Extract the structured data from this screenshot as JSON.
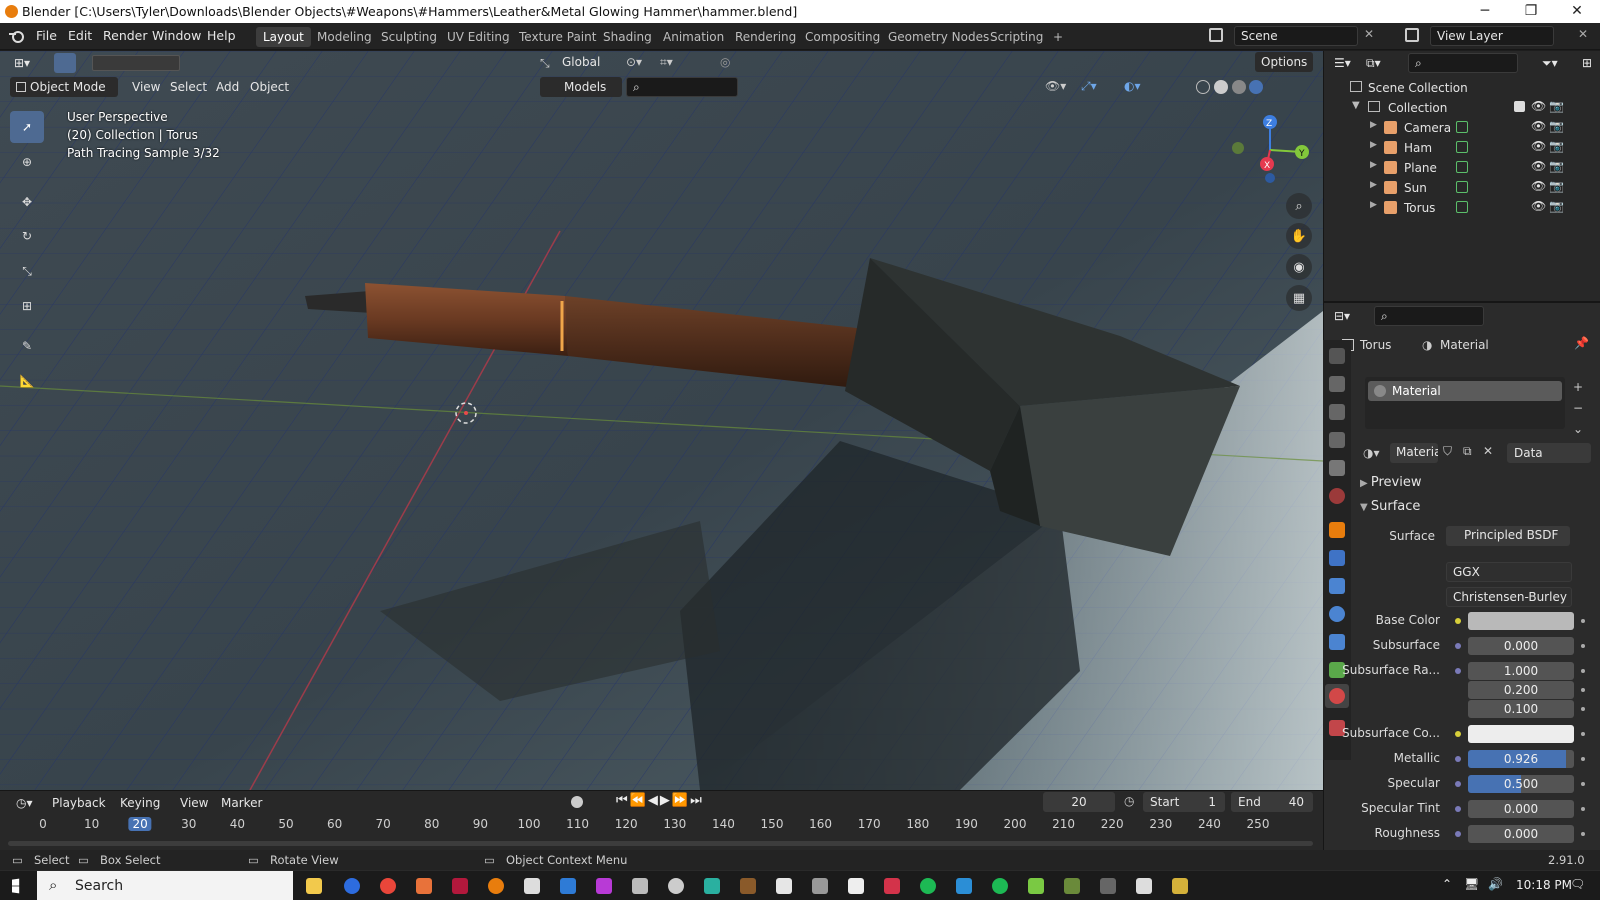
{
  "window": {
    "title": "Blender [C:\\Users\\Tyler\\Downloads\\Blender Objects\\#Weapons\\#Hammers\\Leather&Metal Glowing Hammer\\hammer.blend]",
    "min": "─",
    "max": "❐",
    "close": "✕"
  },
  "menu": [
    "File",
    "Edit",
    "Render",
    "Window",
    "Help"
  ],
  "workspaces": [
    "Layout",
    "Modeling",
    "Sculpting",
    "UV Editing",
    "Texture Paint",
    "Shading",
    "Animation",
    "Rendering",
    "Compositing",
    "Geometry Nodes",
    "Scripting"
  ],
  "add_workspace": "+",
  "scene": "Scene",
  "view_layer": "View Layer",
  "toolbar": {
    "orientation": "Global",
    "options": "Options"
  },
  "viewport_header": {
    "mode": "Object Mode",
    "view": "View",
    "select": "Select",
    "add": "Add",
    "object": "Object",
    "collection_filter": "Models"
  },
  "overlay": {
    "line1": "User Perspective",
    "line2": "(20) Collection | Torus",
    "line3": "Path Tracing Sample 3/32"
  },
  "gizmo": {
    "z": "Z",
    "y": "Y",
    "x": "X"
  },
  "timeline": {
    "playback": "Playback",
    "keying": "Keying",
    "view": "View",
    "marker": "Marker",
    "current_frame": "20",
    "start_label": "Start",
    "start": "1",
    "end_label": "End",
    "end": "40",
    "ticks": [
      "0",
      "10",
      "20",
      "30",
      "40",
      "50",
      "60",
      "70",
      "80",
      "90",
      "100",
      "110",
      "120",
      "130",
      "140",
      "150",
      "160",
      "170",
      "180",
      "190",
      "200",
      "210",
      "220",
      "230",
      "240",
      "250"
    ],
    "active_tick": "20"
  },
  "status": {
    "select": "Select",
    "box_select": "Box Select",
    "rotate": "Rotate View",
    "context": "Object Context Menu",
    "version": "2.91.0"
  },
  "outliner": {
    "scene_collection": "Scene Collection",
    "collection": "Collection",
    "items": [
      "Camera",
      "Ham",
      "Plane",
      "Sun",
      "Torus"
    ]
  },
  "properties": {
    "object": "Torus",
    "tab": "Material",
    "slot": "Material",
    "material_name": "Material",
    "link": "Data",
    "preview": "Preview",
    "surface_section": "Surface",
    "surface_label": "Surface",
    "surface_value": "Principled BSDF",
    "distribution": "GGX",
    "subsurface_method": "Christensen-Burley",
    "fields": [
      {
        "label": "Base Color",
        "value": ""
      },
      {
        "label": "Subsurface",
        "value": "0.000"
      },
      {
        "label": "Subsurface Ra...",
        "value": "1.000"
      },
      {
        "label": "",
        "value": "0.200"
      },
      {
        "label": "",
        "value": "0.100"
      },
      {
        "label": "Subsurface Co...",
        "value": ""
      },
      {
        "label": "Metallic",
        "value": "0.926"
      },
      {
        "label": "Specular",
        "value": "0.500"
      },
      {
        "label": "Specular Tint",
        "value": "0.000"
      },
      {
        "label": "Roughness",
        "value": "0.000"
      }
    ],
    "metallic_fraction": 0.926,
    "specular_fraction": 0.5
  },
  "taskbar": {
    "search": "Search",
    "time": "10:18 PM"
  },
  "colors": {
    "accent": "#4772b3",
    "active_tool": "#4e6a92",
    "blender_orange": "#e87d0d",
    "x_axis": "#e5394f",
    "y_axis": "#83c83b",
    "z_axis": "#3d7ee0"
  }
}
